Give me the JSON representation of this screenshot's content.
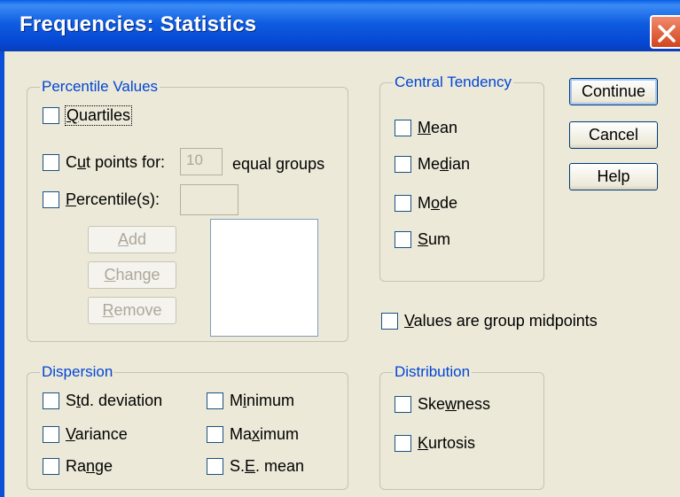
{
  "window": {
    "title": "Frequencies: Statistics"
  },
  "percentile_values": {
    "legend": "Percentile Values",
    "quartiles": {
      "pre": "",
      "key": "Q",
      "post": "uartiles"
    },
    "cut_points": {
      "pre": "C",
      "key": "u",
      "post": "t points for:",
      "value": "10",
      "suffix": "equal groups"
    },
    "percentiles": {
      "pre": "",
      "key": "P",
      "post": "ercentile(s):",
      "value": ""
    },
    "add": {
      "pre": "",
      "key": "A",
      "post": "dd"
    },
    "change": {
      "pre": "",
      "key": "C",
      "post": "hange"
    },
    "remove": {
      "pre": "",
      "key": "R",
      "post": "emove"
    }
  },
  "central_tendency": {
    "legend": "Central Tendency",
    "mean": {
      "pre": "",
      "key": "M",
      "post": "ean"
    },
    "median": {
      "pre": "Me",
      "key": "d",
      "post": "ian"
    },
    "mode": {
      "pre": "M",
      "key": "o",
      "post": "de"
    },
    "sum": {
      "pre": "",
      "key": "S",
      "post": "um"
    }
  },
  "buttons": {
    "continue": "Continue",
    "cancel": "Cancel",
    "help": "Help"
  },
  "group_midpoints": {
    "pre": "",
    "key": "V",
    "post": "alues are group midpoints"
  },
  "dispersion": {
    "legend": "Dispersion",
    "std_deviation": {
      "pre": "S",
      "key": "t",
      "post": "d. deviation"
    },
    "variance": {
      "pre": "",
      "key": "V",
      "post": "ariance"
    },
    "range": {
      "pre": "Ra",
      "key": "n",
      "post": "ge"
    },
    "minimum": {
      "pre": "M",
      "key": "i",
      "post": "nimum"
    },
    "maximum": {
      "pre": "Ma",
      "key": "x",
      "post": "imum"
    },
    "se_mean": {
      "pre": "S.",
      "key": "E",
      "post": ". mean"
    }
  },
  "distribution": {
    "legend": "Distribution",
    "skewness": {
      "pre": "Ske",
      "key": "w",
      "post": "ness"
    },
    "kurtosis": {
      "pre": "",
      "key": "K",
      "post": "urtosis"
    }
  }
}
